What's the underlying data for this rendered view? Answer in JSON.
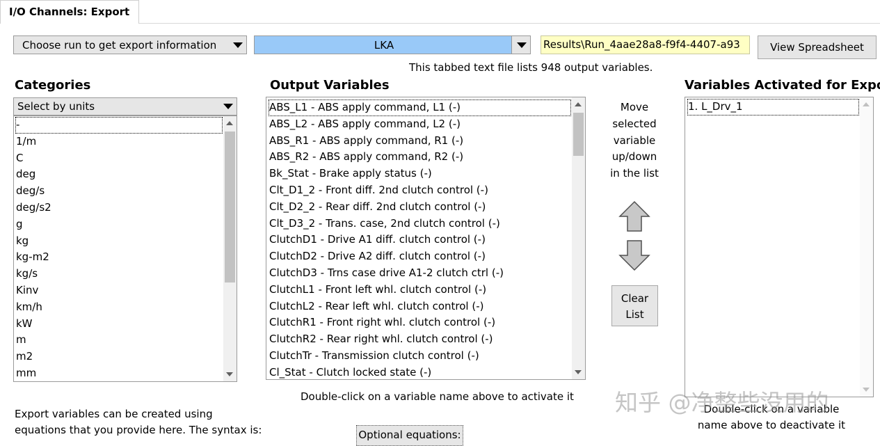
{
  "tab": {
    "label": "I/O Channels: Export"
  },
  "run_select": {
    "value": "Choose run to get export information"
  },
  "run_name": {
    "value": "LKA"
  },
  "results_path": {
    "value": "Results\\Run_4aae28a8-f9f4-4407-a93"
  },
  "view_spreadsheet": {
    "label": "View Spreadsheet"
  },
  "info_text": "This tabbed text file lists 948 output variables.",
  "categories": {
    "heading": "Categories",
    "select_value": "Select by units",
    "items": [
      "-",
      "1/m",
      "C",
      "deg",
      "deg/s",
      "deg/s2",
      "g",
      "kg",
      "kg-m2",
      "kg/s",
      "Kinv",
      "km/h",
      "kW",
      "m",
      "m2",
      "mm"
    ]
  },
  "output_variables": {
    "heading": "Output Variables",
    "items": [
      "ABS_L1 - ABS apply command, L1 (-)",
      "ABS_L2 - ABS apply command, L2 (-)",
      "ABS_R1 - ABS apply command, R1 (-)",
      "ABS_R2 - ABS apply command, R2 (-)",
      "Bk_Stat - Brake apply status (-)",
      "Clt_D1_2 - Front diff. 2nd clutch control (-)",
      "Clt_D2_2 - Rear diff. 2nd clutch control (-)",
      "Clt_D3_2 - Trans. case, 2nd clutch control (-)",
      "ClutchD1 - Drive A1 diff. clutch control (-)",
      "ClutchD2 - Drive A2 diff. clutch control (-)",
      "ClutchD3 - Trns case drive A1-2 clutch ctrl (-)",
      "ClutchL1 - Front left whl. clutch control (-)",
      "ClutchL2 - Rear left whl. clutch control (-)",
      "ClutchR1 - Front right whl. clutch control (-)",
      "ClutchR2 - Rear right whl. clutch control (-)",
      "ClutchTr - Transmission clutch control (-)",
      "Cl_Stat - Clutch locked state (-)"
    ],
    "hint": "Double-click on a variable name above to activate it"
  },
  "move": {
    "lines": [
      "Move",
      "selected",
      "variable",
      "up/down",
      "in the list"
    ]
  },
  "clear": {
    "line1": "Clear",
    "line2": "List"
  },
  "activated": {
    "heading": "Variables Activated for Export",
    "items": [
      "1. L_Drv_1"
    ],
    "hint_line1": "Double-click on a variable",
    "hint_line2": "name above to deactivate it"
  },
  "equations": {
    "line1": "Export variables can be created using",
    "line2": "equations that you provide here. The syntax is:",
    "button": "Optional equations:"
  },
  "watermark": "知乎 @净整些没用的",
  "colors": {
    "lka_bg": "#99c9f8",
    "path_bg": "#ffffc4"
  }
}
